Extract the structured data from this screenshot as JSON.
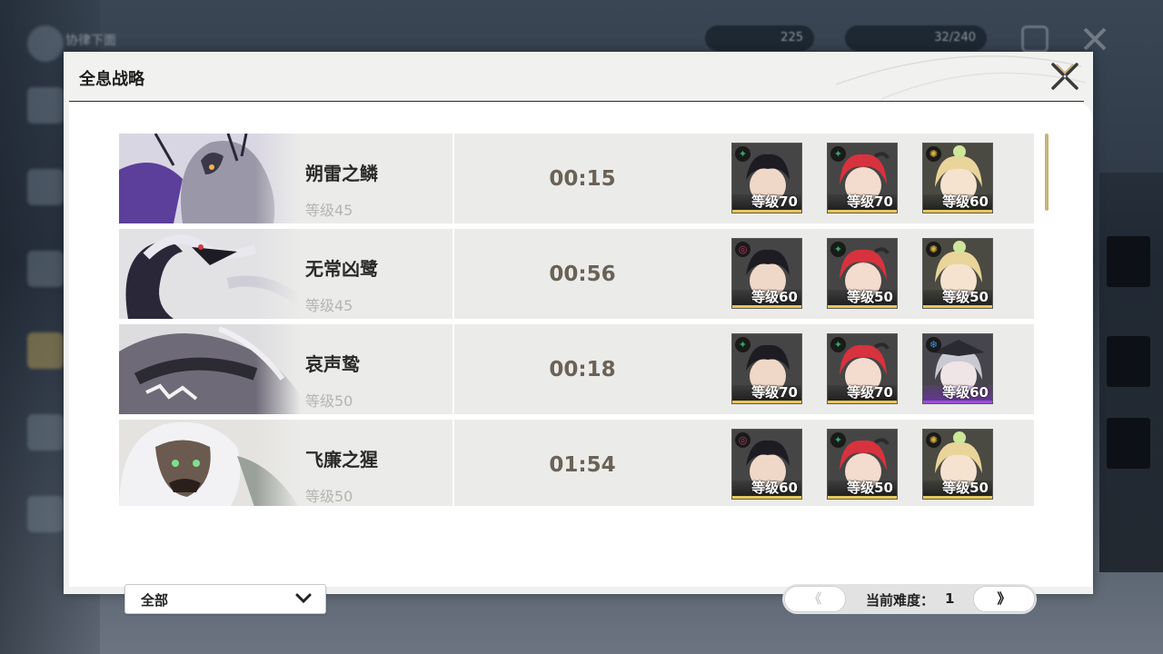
{
  "background": {
    "top_title": "协律下面",
    "currency_a": "225",
    "currency_b": "32/240"
  },
  "panel": {
    "title": "全息战略"
  },
  "rows": [
    {
      "boss_name": "朔雷之鳞",
      "boss_level": "等级45",
      "time": "00:15",
      "team": [
        {
          "level": "等级70",
          "element": "aero",
          "element_color": "#2fa86a",
          "hair": "#1c1c22",
          "rarity": "#e8c65a"
        },
        {
          "level": "等级70",
          "element": "aero",
          "element_color": "#2fa86a",
          "hair": "#d8323e",
          "rarity": "#e8c65a"
        },
        {
          "level": "等级60",
          "element": "spectro",
          "element_color": "#d8b23a",
          "hair": "#e9d49a",
          "rarity": "#e8c65a"
        }
      ]
    },
    {
      "boss_name": "无常凶鹭",
      "boss_level": "等级45",
      "time": "00:56",
      "team": [
        {
          "level": "等级60",
          "element": "fusion",
          "element_color": "#c23a68",
          "hair": "#1c1c22",
          "rarity": "#e8c65a"
        },
        {
          "level": "等级50",
          "element": "aero",
          "element_color": "#2fa86a",
          "hair": "#d8323e",
          "rarity": "#e8c65a"
        },
        {
          "level": "等级50",
          "element": "spectro",
          "element_color": "#d8b23a",
          "hair": "#e9d49a",
          "rarity": "#e8c65a"
        }
      ]
    },
    {
      "boss_name": "哀声鸷",
      "boss_level": "等级50",
      "time": "00:18",
      "team": [
        {
          "level": "等级70",
          "element": "aero",
          "element_color": "#2fa86a",
          "hair": "#1c1c22",
          "rarity": "#e8c65a"
        },
        {
          "level": "等级70",
          "element": "aero",
          "element_color": "#2fa86a",
          "hair": "#d8323e",
          "rarity": "#e8c65a"
        },
        {
          "level": "等级60",
          "element": "glacio",
          "element_color": "#3a8fd8",
          "hair": "#c9c9d2",
          "rarity": "#9b4fd8"
        }
      ]
    },
    {
      "boss_name": "飞廉之猩",
      "boss_level": "等级50",
      "time": "01:54",
      "team": [
        {
          "level": "等级60",
          "element": "fusion",
          "element_color": "#c23a68",
          "hair": "#1c1c22",
          "rarity": "#e8c65a"
        },
        {
          "level": "等级50",
          "element": "aero",
          "element_color": "#2fa86a",
          "hair": "#d8323e",
          "rarity": "#e8c65a"
        },
        {
          "level": "等级50",
          "element": "spectro",
          "element_color": "#d8b23a",
          "hair": "#e9d49a",
          "rarity": "#e8c65a"
        }
      ]
    }
  ],
  "footer": {
    "filter_label": "全部",
    "difficulty_label": "当前难度：",
    "difficulty_value": "1",
    "prev_symbol": "《",
    "next_symbol": "》"
  }
}
